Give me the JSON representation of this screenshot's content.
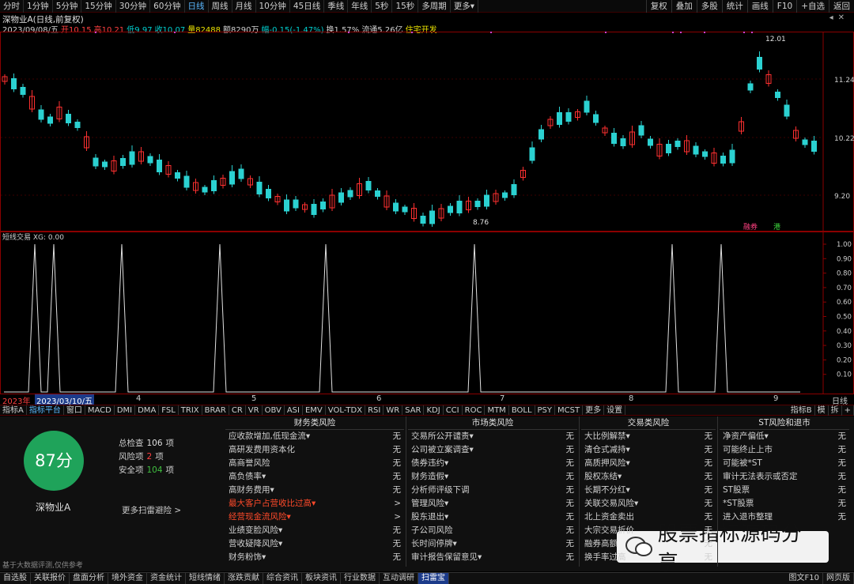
{
  "topbar": {
    "periods": [
      "分时",
      "1分钟",
      "5分钟",
      "15分钟",
      "30分钟",
      "60分钟",
      "日线",
      "周线",
      "月线",
      "10分钟",
      "45日线",
      "季线",
      "年线",
      "5秒",
      "15秒",
      "多周期",
      "更多▾"
    ],
    "active": "日线",
    "right": [
      "复权",
      "叠加",
      "多股",
      "统计",
      "画线",
      "F10",
      "+自选",
      "返回"
    ]
  },
  "chart": {
    "title": "深物业A(日线,前复权)",
    "info": [
      {
        "t": "2023/09/08/五",
        "c": "#d0d0d0"
      },
      {
        "t": "开10.15",
        "c": "#ff4040"
      },
      {
        "t": "高10.21",
        "c": "#ff4040"
      },
      {
        "t": "低9.97",
        "c": "#00d0d0"
      },
      {
        "t": "收10.07",
        "c": "#00d0d0"
      },
      {
        "t": "量82488",
        "c": "#e8e000"
      },
      {
        "t": "额8290万",
        "c": "#d0d0d0"
      },
      {
        "t": "幅-0.15(-1.47%)",
        "c": "#00d0d0"
      },
      {
        "t": "换1.57%",
        "c": "#d0d0d0"
      },
      {
        "t": "流通5.26亿",
        "c": "#d0d0d0"
      },
      {
        "t": "住宅开发",
        "c": "#e8e000"
      }
    ],
    "price_labels": [
      "11.24",
      "10.22",
      "9.20"
    ],
    "high_label": "12.01",
    "low_label": "8.76",
    "badges": [
      "融券",
      "港"
    ],
    "indicator_title": "短线交易 XG: 0.00",
    "ind_axis": [
      "1.00",
      "0.90",
      "0.80",
      "0.70",
      "0.60",
      "0.50",
      "0.40",
      "0.30",
      "0.20",
      "0.10"
    ]
  },
  "datebar": {
    "year": "2023年",
    "cursor": "2023/03/10/五",
    "months": [
      "4",
      "5",
      "6",
      "7",
      "8",
      "9"
    ],
    "right": "日线"
  },
  "tabs": {
    "items": [
      "指标A",
      "指标平台",
      "窗口",
      "MACD",
      "DMI",
      "DMA",
      "FSL",
      "TRIX",
      "BRAR",
      "CR",
      "VR",
      "OBV",
      "ASI",
      "EMV",
      "VOL-TDX",
      "RSI",
      "WR",
      "SAR",
      "KDJ",
      "CCI",
      "ROC",
      "MTM",
      "BOLL",
      "PSY",
      "MCST",
      "更多",
      "设置"
    ],
    "active": "指标平台",
    "right": [
      "指标B",
      "模",
      "拆",
      "+"
    ]
  },
  "risk": {
    "score": "87分",
    "name": "深物业A",
    "more": "更多扫雷避险 >",
    "stats": [
      {
        "l": "总检查",
        "v": "106",
        "u": "项",
        "c": "#e0e0e0"
      },
      {
        "l": "风险项",
        "v": "2",
        "u": "项",
        "c": "#ff4040"
      },
      {
        "l": "安全项",
        "v": "104",
        "u": "项",
        "c": "#40c040"
      }
    ],
    "footnote": "基于大数据评测,仅供参考",
    "columns": [
      {
        "title": "财务类风险",
        "rows": [
          [
            "应收款增加,低现金流▾",
            "无",
            0
          ],
          [
            "高研发费用资本化",
            "无",
            0
          ],
          [
            "高商誉风险",
            "无",
            0
          ],
          [
            "高负债率▾",
            "无",
            0
          ],
          [
            "高财务费用▾",
            "无",
            0
          ],
          [
            "最大客户占营收比过高▾",
            ">",
            1
          ],
          [
            "经营现金流风险▾",
            ">",
            1
          ],
          [
            "业绩变脸风险▾",
            "无",
            0
          ],
          [
            "营收疑降风险▾",
            "无",
            0
          ],
          [
            "财务粉饰▾",
            "无",
            0
          ]
        ]
      },
      {
        "title": "市场类风险",
        "rows": [
          [
            "交易所公开谴责▾",
            "无",
            0
          ],
          [
            "公司被立案调查▾",
            "无",
            0
          ],
          [
            "债券违约▾",
            "无",
            0
          ],
          [
            "财务造假▾",
            "无",
            0
          ],
          [
            "分析师评级下调",
            "无",
            0
          ],
          [
            "管理风险▾",
            "无",
            0
          ],
          [
            "股东退出▾",
            "无",
            0
          ],
          [
            "子公司风险",
            "无",
            0
          ],
          [
            "长时间停牌▾",
            "无",
            0
          ],
          [
            "审计报告保留意见▾",
            "无",
            0
          ]
        ]
      },
      {
        "title": "交易类风险",
        "rows": [
          [
            "大比例解禁▾",
            "无",
            0
          ],
          [
            "清仓式减持▾",
            "无",
            0
          ],
          [
            "高质押风险▾",
            "无",
            0
          ],
          [
            "股权冻结▾",
            "无",
            0
          ],
          [
            "长期不分红▾",
            "无",
            0
          ],
          [
            "关联交易风险▾",
            "无",
            0
          ],
          [
            "北上资金卖出",
            "无",
            0
          ],
          [
            "大宗交易折价",
            "无",
            0
          ],
          [
            "融券高额",
            "无",
            0
          ],
          [
            "换手率过高",
            "无",
            0
          ]
        ]
      },
      {
        "title": "ST风险和退市",
        "rows": [
          [
            "净资产偏低▾",
            "无",
            0
          ],
          [
            "可能终止上市",
            "无",
            0
          ],
          [
            "可能被*ST",
            "无",
            0
          ],
          [
            "审计无法表示或否定",
            "无",
            0
          ],
          [
            "ST股票",
            "无",
            0
          ],
          [
            "*ST股票",
            "无",
            0
          ],
          [
            "进入退市整理",
            "无",
            0
          ]
        ]
      }
    ]
  },
  "watermark": "股票指标源码分享",
  "bottom": {
    "items": [
      "自选股",
      "关联报价",
      "盘面分析",
      "境外资金",
      "资金统计",
      "短线情绪",
      "涨跌贡献",
      "综合资讯",
      "板块资讯",
      "行业数据",
      "互动调研",
      "扫雷宝"
    ],
    "active": "扫雷宝",
    "right": [
      "图文F10",
      "网页版"
    ]
  }
}
